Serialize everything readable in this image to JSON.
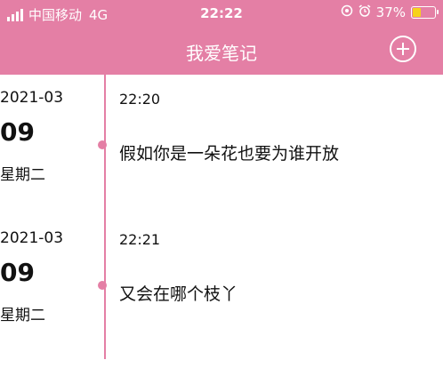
{
  "status_bar": {
    "carrier": "中国移动",
    "network": "4G",
    "time": "22:22",
    "battery_percent": "37%",
    "accent_color": "#e47fa5"
  },
  "header": {
    "title": "我爱笔记",
    "add_icon": "plus-circle-icon"
  },
  "entries": [
    {
      "year_month": "2021-03",
      "day": "09",
      "weekday": "星期二",
      "time": "22:20",
      "text": "假如你是一朵花也要为谁开放"
    },
    {
      "year_month": "2021-03",
      "day": "09",
      "weekday": "星期二",
      "time": "22:21",
      "text": "又会在哪个枝丫"
    }
  ]
}
